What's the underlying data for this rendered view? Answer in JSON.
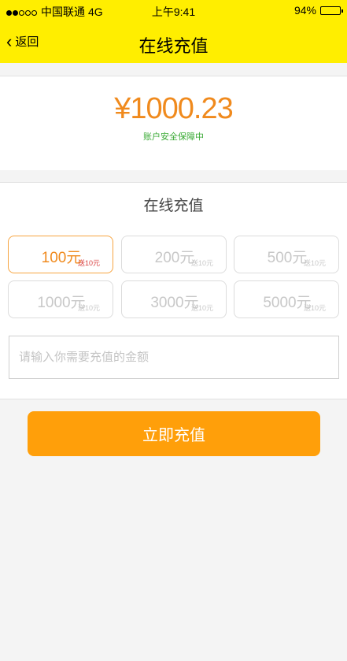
{
  "status_bar": {
    "carrier": "中国联通",
    "network": "4G",
    "time": "上午9:41",
    "battery": "94%",
    "battery_level": 0.94
  },
  "nav": {
    "back_label": "返回",
    "title": "在线充值"
  },
  "balance": {
    "amount": "¥1000.23",
    "security_note": "账户安全保障中"
  },
  "recharge": {
    "title": "在线充值",
    "options": [
      {
        "value": "100元",
        "bonus": "送10元",
        "selected": true
      },
      {
        "value": "200元",
        "bonus": "送10元",
        "selected": false
      },
      {
        "value": "500元",
        "bonus": "送10元",
        "selected": false
      },
      {
        "value": "1000元",
        "bonus": "送10元",
        "selected": false
      },
      {
        "value": "3000元",
        "bonus": "送10元",
        "selected": false
      },
      {
        "value": "5000元",
        "bonus": "送10元",
        "selected": false
      }
    ],
    "input_placeholder": "请输入你需要充值的金额",
    "input_value": ""
  },
  "submit_label": "立即充值",
  "colors": {
    "header_bg": "#ffee00",
    "accent": "#f08a1d",
    "button_bg": "#ff9f0a",
    "secure_green": "#3aaa35",
    "bonus_red": "#d94040"
  }
}
